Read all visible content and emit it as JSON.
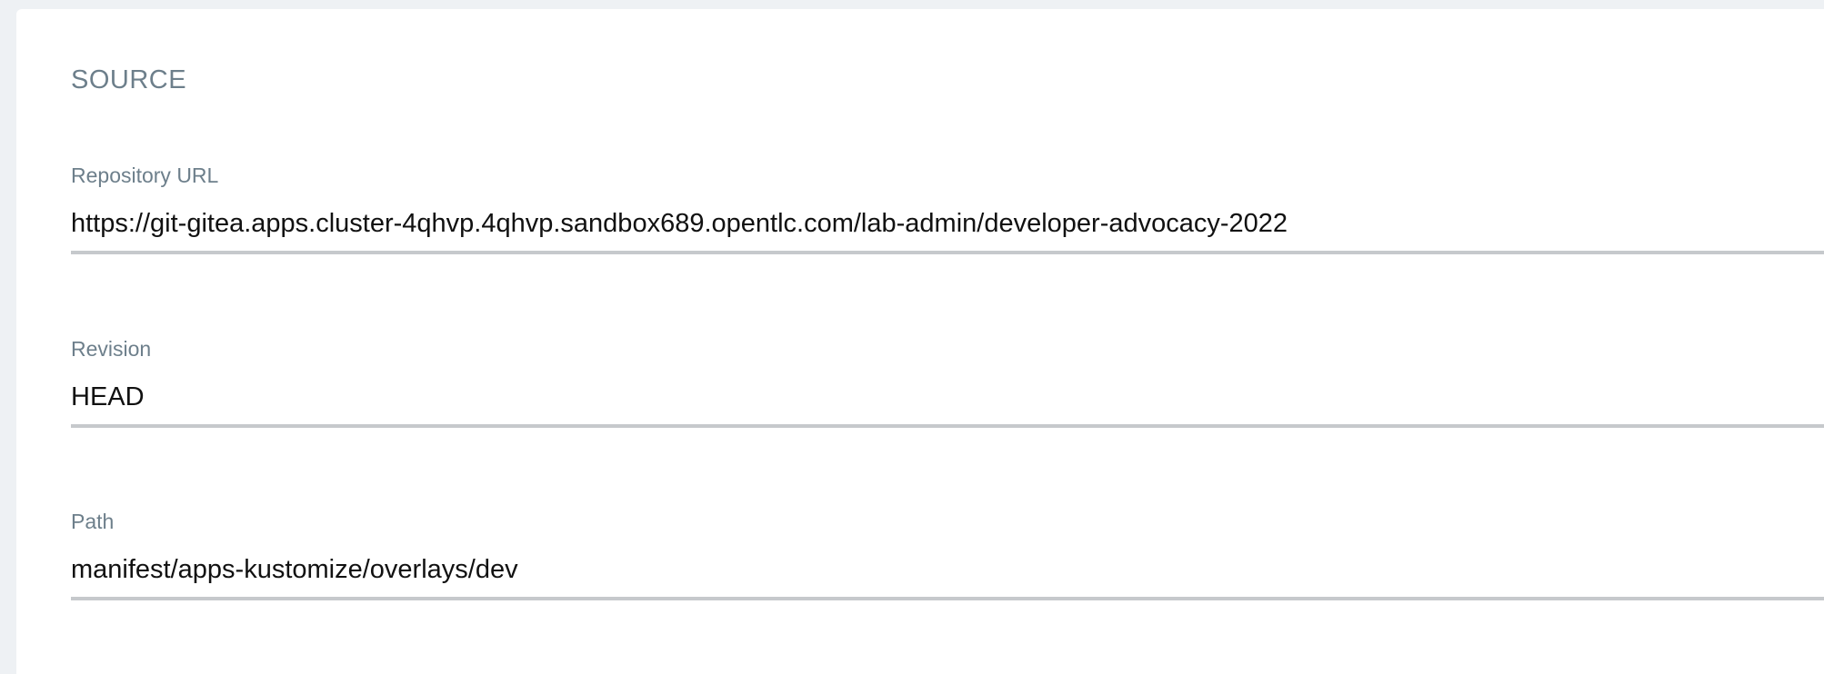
{
  "section": {
    "title": "SOURCE"
  },
  "fields": [
    {
      "label": "Repository URL",
      "value": "https://git-gitea.apps.cluster-4qhvp.4qhvp.sandbox689.opentlc.com/lab-admin/developer-advocacy-2022"
    },
    {
      "label": "Revision",
      "value": "HEAD"
    },
    {
      "label": "Path",
      "value": "manifest/apps-kustomize/overlays/dev"
    }
  ],
  "colors": {
    "background": "#eef1f4",
    "panel": "#ffffff",
    "label": "#6d7f8b",
    "value": "#111111",
    "underline": "#c6c9cc"
  }
}
